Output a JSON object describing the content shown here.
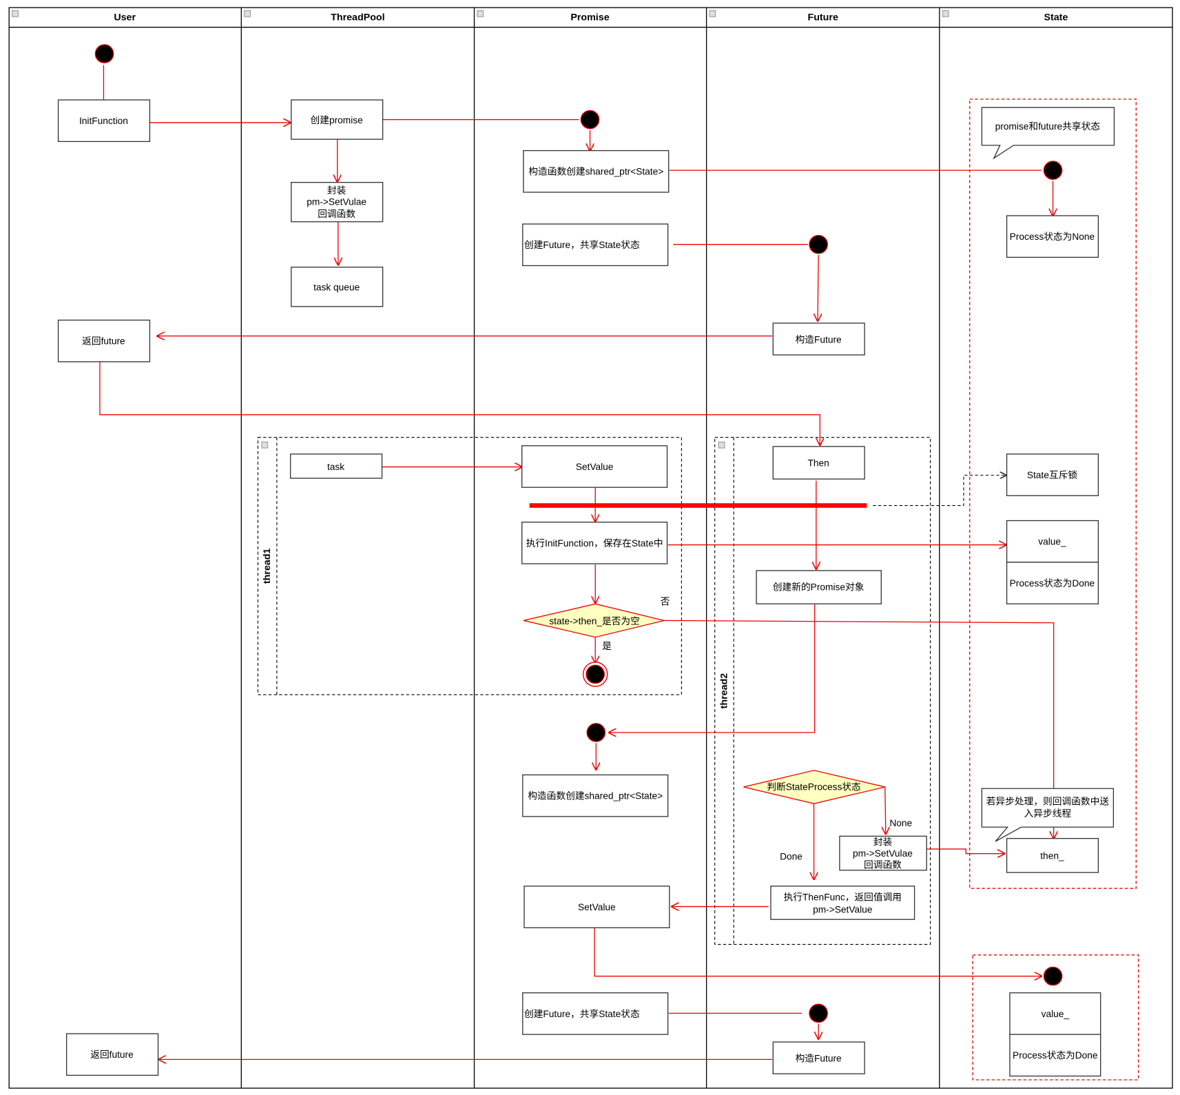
{
  "lanes": [
    {
      "title": "User"
    },
    {
      "title": "ThreadPool"
    },
    {
      "title": "Promise"
    },
    {
      "title": "Future"
    },
    {
      "title": "State"
    }
  ],
  "threads": {
    "thread1": "thread1",
    "thread2": "thread2"
  },
  "user": {
    "init_function": "InitFunction",
    "return_future_1": "返回future",
    "return_future_2": "返回future"
  },
  "threadpool": {
    "create_promise": "创建promise",
    "wrap_line1": "封装",
    "wrap_line2": "pm->SetVulae",
    "wrap_line3": "回调函数",
    "task_queue": "task queue",
    "task": "task"
  },
  "promise": {
    "ctor_shared_ptr_1": "构造函数创建shared_ptr<State>",
    "create_future_1": "创建Future，共享State状态",
    "set_value_1": "SetValue",
    "exec_init": "执行InitFunction，保存在State中",
    "decision_then": "state->then_是否为空",
    "label_no": "否",
    "label_yes": "是",
    "ctor_shared_ptr_2": "构造函数创建shared_ptr<State>",
    "set_value_2": "SetValue",
    "create_future_2": "创建Future，共享State状态"
  },
  "future": {
    "construct_future_1": "构造Future",
    "then": "Then",
    "create_new_promise": "创建新的Promise对象",
    "decision_state": "判断StateProcess状态",
    "label_none": "None",
    "label_done": "Done",
    "wrap_line1": "封装",
    "wrap_line2": "pm->SetVulae",
    "wrap_line3": "回调函数",
    "exec_then_line1": "执行ThenFunc，返回值调用",
    "exec_then_line2": "pm->SetValue",
    "construct_future_2": "构造Future"
  },
  "state": {
    "note_shared": "promise和future共享状态",
    "process_none": "Process状态为None",
    "mutex": "State互斥锁",
    "value_1": "value_",
    "process_done_1": "Process状态为Done",
    "note_async_line1": "若异步处理，则回调函数中送",
    "note_async_line2": "入异步线程",
    "then_field": "then_",
    "value_2": "value_",
    "process_done_2": "Process状态为Done"
  },
  "colors": {
    "flow": "#e00000",
    "decision_fill": "#ffffc0",
    "sync_bar": "#ff0000"
  }
}
